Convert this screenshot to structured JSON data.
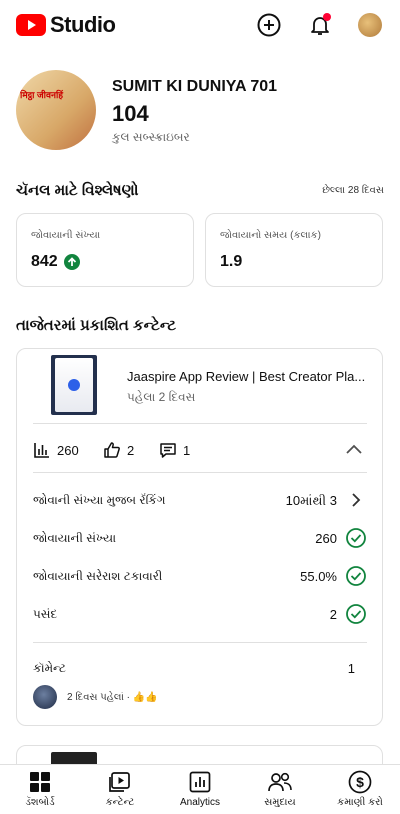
{
  "app": {
    "brand": "Studio"
  },
  "channel": {
    "name": "SUMIT KI DUNIYA 701",
    "subscribers": "104",
    "subscribers_label": "કુલ સબ્સ્ક્રાઇબર",
    "avatar_text": "मिट्ठा जीवनहिं"
  },
  "analytics": {
    "title": "ચૅનલ માટે વિશ્લેષણો",
    "period": "છેલ્લા 28 દિવસ",
    "cards": [
      {
        "label": "જોવાયાની સંખ્યા",
        "value": "842",
        "trend": "up"
      },
      {
        "label": "જોવાયાનો સમય (કલાક)",
        "value": "1.9"
      }
    ]
  },
  "latest": {
    "title": "તાજેતરમાં પ્રકાશિત કન્ટેન્ટ",
    "video": {
      "title": "Jaaspire App Review | Best Creator Pla...",
      "date": "પહેલા 2 દિવસ",
      "views": "260",
      "likes": "2",
      "comments": "1"
    },
    "rows": [
      {
        "label": "જોવાની સંખ્યા મુજબ રૅંકિંગ",
        "value": "10માંથી 3",
        "icon": "chevron-right-icon"
      },
      {
        "label": "જોવાયાની સંખ્યા",
        "value": "260",
        "icon": "check-circle-icon"
      },
      {
        "label": "જોવાયાની સરેરાશ ટકાવારી",
        "value": "55.0%",
        "icon": "check-circle-icon"
      },
      {
        "label": "પસંદ",
        "value": "2",
        "icon": "check-circle-icon"
      }
    ],
    "comments_label": "કૉમેન્ટ",
    "comments_count": "1",
    "latest_comment": "2 દિવસ પહેલાં · 👍👍"
  },
  "nav": [
    {
      "label": "ડૅશબોર્ડ",
      "icon": "dashboard-icon"
    },
    {
      "label": "કન્ટેન્ટ",
      "icon": "content-icon"
    },
    {
      "label": "Analytics",
      "icon": "analytics-icon"
    },
    {
      "label": "સમુદાય",
      "icon": "community-icon"
    },
    {
      "label": "કમાણી કરો",
      "icon": "earn-icon"
    }
  ],
  "colors": {
    "brand_red": "#ff0000",
    "success_green": "#11843e",
    "notification_dot": "#ff0033"
  }
}
